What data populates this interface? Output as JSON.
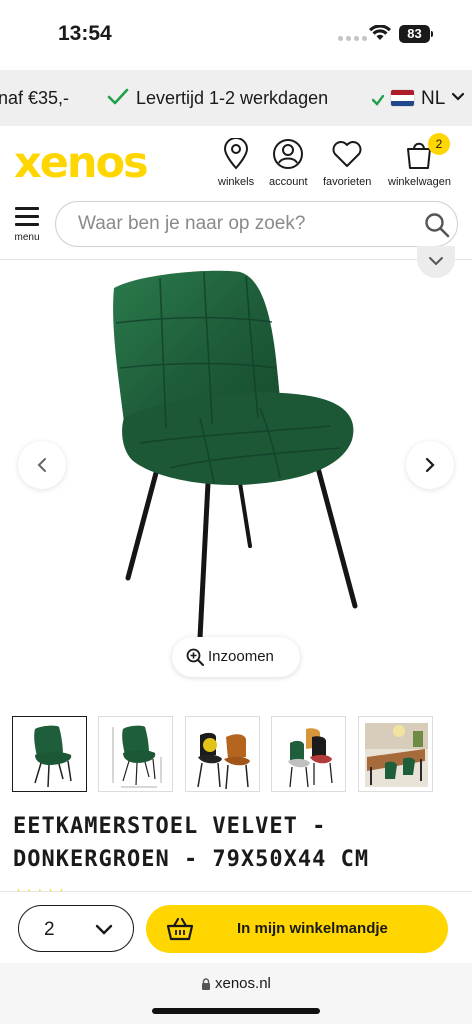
{
  "status_bar": {
    "time": "13:54",
    "battery": "83"
  },
  "promo": {
    "free_shipping_text": "naf €35,-",
    "delivery_text": "Levertijd 1-2 werkdagen"
  },
  "language": {
    "code": "NL",
    "flag_colors": [
      "#ae1c28",
      "#ffffff",
      "#21468b"
    ]
  },
  "brand": {
    "logo": "xenos",
    "logo_color": "#ffd600"
  },
  "header_nav": {
    "stores": "winkels",
    "account": "account",
    "favorites": "favorieten",
    "cart": "winkelwagen",
    "cart_count": "2"
  },
  "menu": {
    "label": "menu"
  },
  "search": {
    "placeholder": "Waar ben je naar op zoek?"
  },
  "gallery": {
    "zoom_label": "Inzoomen",
    "thumbnails": [
      "chair-front-view",
      "chair-dimensions",
      "chairs-yellow-and-brown",
      "chairs-multiple-colors",
      "dining-room-scene"
    ]
  },
  "product": {
    "title": "EETKAMERSTOEL VELVET - DONKERGROEN - 79X50X44 CM",
    "color": "#1f5e3a"
  },
  "purchase": {
    "quantity": "2",
    "add_to_cart_label": "In mijn winkelmandje",
    "button_color": "#ffd600"
  },
  "browser": {
    "url": "xenos.nl"
  }
}
